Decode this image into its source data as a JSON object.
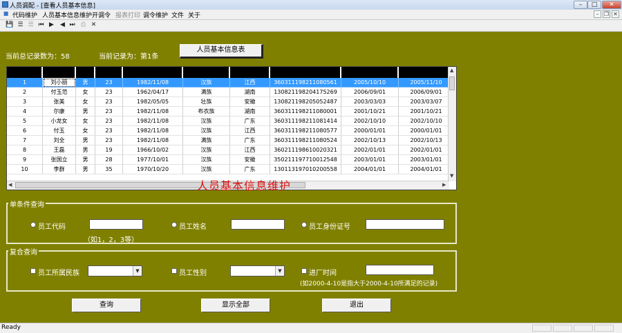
{
  "window": {
    "title": "人员调配 - [查看人员基本信息]"
  },
  "menu": {
    "items": [
      {
        "label": "代码维护",
        "enabled": true
      },
      {
        "label": "人员基本信息维护",
        "enabled": true
      },
      {
        "label": "开调令",
        "enabled": true
      },
      {
        "label": "报表打印",
        "enabled": false
      },
      {
        "label": "调令维护",
        "enabled": true
      },
      {
        "label": "文件",
        "enabled": true
      },
      {
        "label": "关于",
        "enabled": true
      }
    ]
  },
  "toolbar": {
    "icons": [
      "save-icon",
      "list-icon",
      "list-disabled-icon",
      "first-record-icon",
      "prev-record-icon",
      "next-record-icon",
      "last-record-icon",
      "print-icon",
      "close-icon"
    ]
  },
  "summary": {
    "total_label": "当前总记录数为：58",
    "current_label": "当前记录为：第1条",
    "info_button": "人员基本信息表"
  },
  "grid": {
    "rows": [
      [
        "1",
        "刘小丽",
        "男",
        "23",
        "1982/11/08",
        "汉族",
        "江西",
        "360311198211080561",
        "2005/10/10",
        "2005/11/10"
      ],
      [
        "2",
        "付玉范",
        "女",
        "23",
        "1962/04/17",
        "满族",
        "湖南",
        "130821198204175269",
        "2006/09/01",
        "2006/09/01"
      ],
      [
        "3",
        "张美",
        "女",
        "23",
        "1982/05/05",
        "壮族",
        "安徽",
        "130821198205052487",
        "2003/03/03",
        "2003/03/07"
      ],
      [
        "4",
        "尔康",
        "男",
        "23",
        "1982/11/08",
        "布衣族",
        "湖南",
        "360311198211080001",
        "2001/10/21",
        "2001/10/21"
      ],
      [
        "5",
        "小龙女",
        "女",
        "23",
        "1982/11/08",
        "汉族",
        "广东",
        "360311198211081414",
        "2002/10/10",
        "2002/10/10"
      ],
      [
        "6",
        "付玉",
        "女",
        "23",
        "1982/11/08",
        "汉族",
        "江西",
        "360311198211080577",
        "2000/01/01",
        "2000/01/01"
      ],
      [
        "7",
        "刘全",
        "男",
        "23",
        "1982/11/08",
        "满族",
        "广东",
        "360311198211080524",
        "2002/10/13",
        "2002/10/13"
      ],
      [
        "8",
        "王磊",
        "男",
        "19",
        "1966/10/02",
        "汉族",
        "江西",
        "360211198610020321",
        "2002/01/01",
        "2002/01/01"
      ],
      [
        "9",
        "张国立",
        "男",
        "28",
        "1977/10/01",
        "汉族",
        "安徽",
        "350211197710012548",
        "2003/01/01",
        "2003/01/01"
      ],
      [
        "10",
        "李群",
        "男",
        "35",
        "1970/10/20",
        "汉族",
        "广东",
        "130113197010200558",
        "2004/01/01",
        "2004/01/01"
      ]
    ],
    "selected_row": 0,
    "overlay_title": "人员基本信息维护"
  },
  "single_query": {
    "title": "单条件查询",
    "radio_code": "员工代码",
    "radio_name": "员工姓名",
    "radio_id": "员工身份证号",
    "hint": "（如1，2，3等）",
    "code_value": "",
    "name_value": "",
    "id_value": ""
  },
  "compound_query": {
    "title": "复合查询",
    "cb_nation": "员工所属民族",
    "cb_gender": "员工性别",
    "cb_date": "进厂时间",
    "hint": "(如2000-4-10是指大于2000-4-10所满足的记录)",
    "nation_value": "",
    "gender_value": "",
    "date_value": ""
  },
  "buttons": {
    "query": "查询",
    "show_all": "显示全部",
    "exit": "退出"
  },
  "status": {
    "text": "Ready"
  },
  "colors": {
    "background": "#808000",
    "selection": "#3399ff",
    "overlay_text": "#e01010"
  }
}
